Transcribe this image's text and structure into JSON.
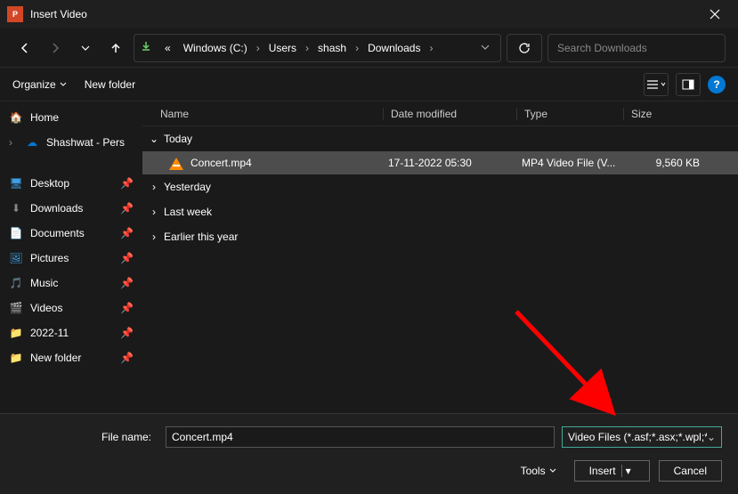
{
  "window": {
    "title": "Insert Video",
    "app_icon_text": "P"
  },
  "nav": {
    "breadcrumb_prefix": "«",
    "segments": [
      "Windows (C:)",
      "Users",
      "shash",
      "Downloads"
    ],
    "search_placeholder": "Search Downloads"
  },
  "toolbar": {
    "organize": "Organize",
    "new_folder": "New folder",
    "help": "?"
  },
  "sidebar": {
    "home": "Home",
    "onedrive": "Shashwat - Pers",
    "quick": [
      {
        "icon": "desktop",
        "label": "Desktop"
      },
      {
        "icon": "down",
        "label": "Downloads"
      },
      {
        "icon": "doc",
        "label": "Documents"
      },
      {
        "icon": "pic",
        "label": "Pictures"
      },
      {
        "icon": "music",
        "label": "Music"
      },
      {
        "icon": "video",
        "label": "Videos"
      },
      {
        "icon": "folder",
        "label": "2022-11"
      },
      {
        "icon": "folder",
        "label": "New folder"
      }
    ]
  },
  "columns": {
    "name": "Name",
    "date": "Date modified",
    "type": "Type",
    "size": "Size"
  },
  "groups": {
    "today": "Today",
    "yesterday": "Yesterday",
    "last_week": "Last week",
    "earlier_year": "Earlier this year"
  },
  "files": {
    "today": [
      {
        "name": "Concert.mp4",
        "date": "17-11-2022 05:30",
        "type": "MP4 Video File (V...",
        "size": "9,560 KB"
      }
    ]
  },
  "footer": {
    "filename_label": "File name:",
    "filename_value": "Concert.mp4",
    "filter": "Video Files (*.asf;*.asx;*.wpl;*.w",
    "tools": "Tools",
    "insert": "Insert",
    "cancel": "Cancel"
  }
}
